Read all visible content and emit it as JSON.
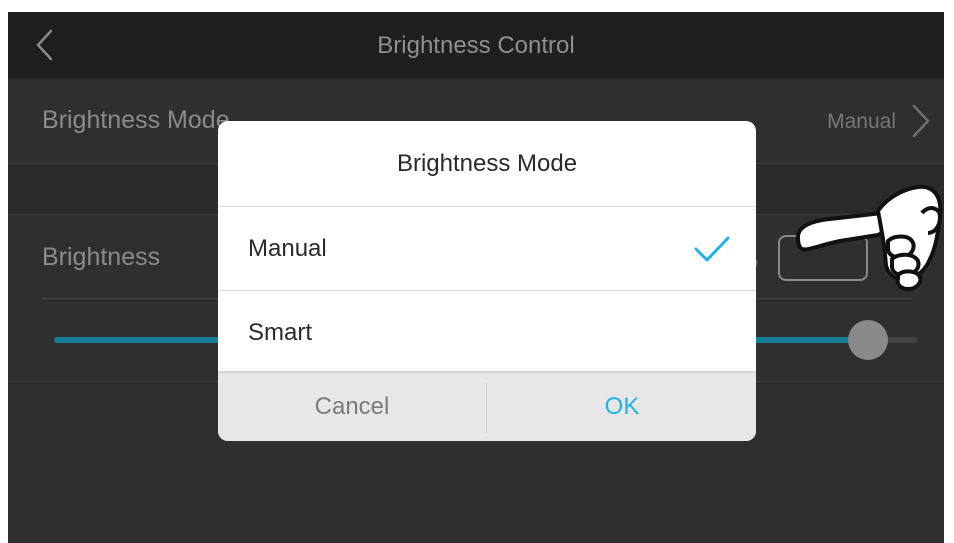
{
  "window": {
    "title": "Brightness Control",
    "back_icon": "chevron-left-icon"
  },
  "settings": {
    "mode_row": {
      "label": "Brightness Mode",
      "value": "Manual",
      "chevron_icon": "chevron-right-icon"
    },
    "brightness_row": {
      "label": "Brightness",
      "percent_symbol": "%"
    },
    "slider": {
      "level": 0.93
    }
  },
  "dialog": {
    "title": "Brightness Mode",
    "options": [
      {
        "label": "Manual",
        "selected": true
      },
      {
        "label": "Smart",
        "selected": false
      }
    ],
    "cancel_label": "Cancel",
    "ok_label": "OK",
    "check_icon": "checkmark-icon"
  },
  "colors": {
    "accent": "#22b3e6",
    "slider_fill": "#157f96",
    "background": "#2f2f2f",
    "titlebar": "#1f1f1f"
  },
  "overlay": {
    "pointer_icon": "pointing-hand-icon"
  }
}
